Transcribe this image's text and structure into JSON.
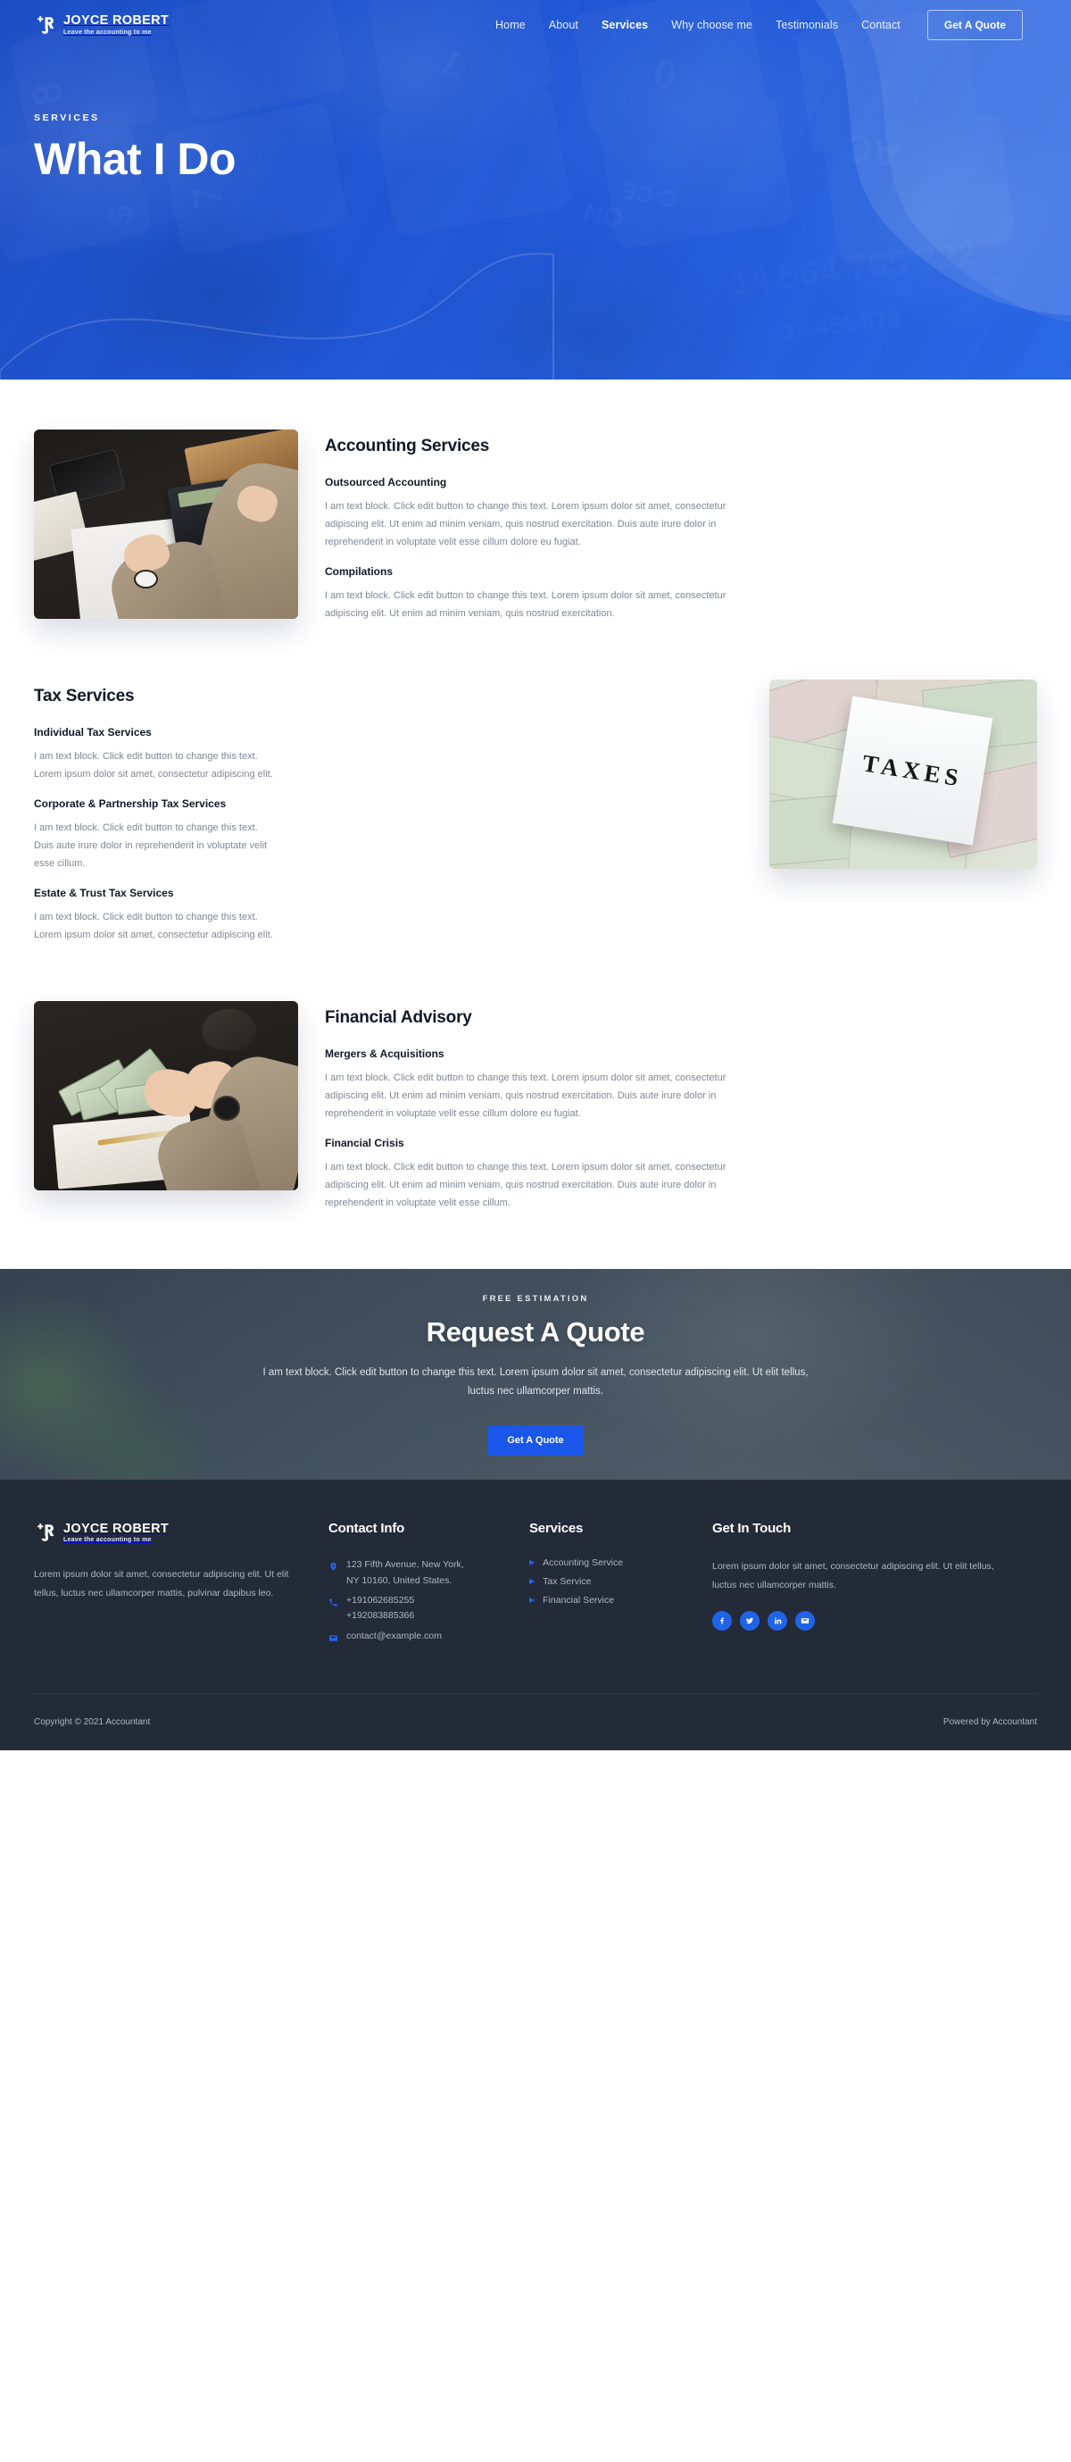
{
  "brand": {
    "name": "JOYCE ROBERT",
    "tagline": "Leave the accounting to me",
    "logo_icon": "jr-monogram-icon"
  },
  "header": {
    "nav": [
      {
        "label": "Home",
        "active": false
      },
      {
        "label": "About",
        "active": false
      },
      {
        "label": "Services",
        "active": true
      },
      {
        "label": "Why choose me",
        "active": false
      },
      {
        "label": "Testimonials",
        "active": false
      },
      {
        "label": "Contact",
        "active": false
      }
    ],
    "cta_label": "Get A Quote"
  },
  "hero": {
    "kicker": "SERVICES",
    "title": "What I Do"
  },
  "sections": [
    {
      "id": "accounting",
      "title": "Accounting Services",
      "image_alt": "accountant-with-calculator-photo",
      "image_position": "left",
      "blocks": [
        {
          "heading": "Outsourced Accounting",
          "text": "I am text block. Click edit button to change this text. Lorem ipsum dolor sit amet, consectetur adipiscing elit. Ut enim ad minim veniam, quis nostrud exercitation.  Duis aute irure dolor in reprehenderit in voluptate velit esse cillum dolore eu fugiat."
        },
        {
          "heading": "Compilations",
          "text": "I am text block. Click edit button to change this text. Lorem ipsum dolor sit amet, consectetur adipiscing elit. Ut enim ad minim veniam, quis nostrud exercitation."
        }
      ]
    },
    {
      "id": "tax",
      "title": "Tax Services",
      "image_alt": "taxes-sign-on-money-photo",
      "image_position": "right",
      "blocks": [
        {
          "heading": "Individual Tax Services",
          "text": "I am text block. Click edit button to change this text. Lorem ipsum dolor sit amet, consectetur adipiscing elit."
        },
        {
          "heading": "Corporate & Partnership Tax Services",
          "text": "I am text block. Click edit button to change this text. Duis aute irure dolor in reprehenderit in voluptate velit esse cillum."
        },
        {
          "heading": "Estate & Trust Tax Services",
          "text": "I am text block. Click edit button to change this text. Lorem ipsum dolor sit amet, consectetur adipiscing elit."
        }
      ]
    },
    {
      "id": "advisory",
      "title": "Financial Advisory",
      "image_alt": "counting-cash-photo",
      "image_position": "left",
      "blocks": [
        {
          "heading": "Mergers & Acquisitions",
          "text": "I am text block. Click edit button to change this text. Lorem ipsum dolor sit amet, consectetur adipiscing elit. Ut enim ad minim veniam, quis nostrud exercitation.  Duis aute irure dolor in reprehenderit in voluptate velit esse cillum dolore eu fugiat."
        },
        {
          "heading": "Financial Crisis",
          "text": "I am text block. Click edit button to change this text. Lorem ipsum dolor sit amet, consectetur adipiscing elit. Ut enim ad minim veniam, quis nostrud exercitation.  Duis aute irure dolor in reprehenderit in voluptate velit esse cillum."
        }
      ]
    }
  ],
  "cta": {
    "kicker": "FREE ESTIMATION",
    "title": "Request A Quote",
    "text": "I am text block. Click edit button to change this text. Lorem ipsum dolor sit amet, consectetur adipiscing elit. Ut elit tellus, luctus nec ullamcorper mattis.",
    "button_label": "Get A Quote"
  },
  "footer": {
    "about_text": "Lorem ipsum dolor sit amet, consectetur adipiscing elit. Ut elit tellus, luctus nec ullamcorper mattis, pulvinar dapibus leo.",
    "contact": {
      "title": "Contact Info",
      "address_line1": "123 Fifth Avenue, New York,",
      "address_line2": "NY 10160, United States.",
      "phone1": "+191062685255",
      "phone2": "+192083885366",
      "email": "contact@example.com",
      "address_icon": "map-pin-icon",
      "phone_icon": "phone-icon",
      "email_icon": "envelope-icon"
    },
    "services": {
      "title": "Services",
      "items": [
        "Accounting Service",
        "Tax Service",
        "Financial Service"
      ],
      "bullet_icon": "caret-right-icon"
    },
    "touch": {
      "title": "Get In Touch",
      "text": "Lorem ipsum dolor sit amet, consectetur adipiscing elit. Ut elit tellus, luctus nec ullamcorper mattis.",
      "socials": [
        {
          "name": "facebook-icon",
          "label": "Facebook"
        },
        {
          "name": "twitter-icon",
          "label": "Twitter"
        },
        {
          "name": "linkedin-icon",
          "label": "LinkedIn"
        },
        {
          "name": "email-icon",
          "label": "Email"
        }
      ]
    },
    "copyright": "Copyright © 2021 Accountant",
    "powered_by": "Powered by Accountant"
  },
  "colors": {
    "hero_blue": "#2553bd",
    "accent_blue": "#1a56e8",
    "footer_dark": "#232a38",
    "cta_slate": "#4b5a69",
    "body_text": "#7f8796",
    "heading": "#111827"
  }
}
